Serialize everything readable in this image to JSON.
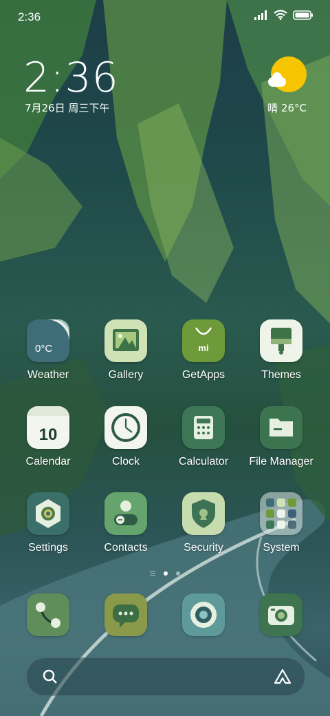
{
  "status_bar": {
    "time": "2:36"
  },
  "clock_widget": {
    "time": "2:36",
    "date": "7月26日 周三下午"
  },
  "weather_widget": {
    "text": "晴 26°C",
    "icon": "sunny-cloud-icon"
  },
  "apps": [
    {
      "label": "Weather",
      "icon_text": "0°C"
    },
    {
      "label": "Gallery"
    },
    {
      "label": "GetApps",
      "icon_text": "mi"
    },
    {
      "label": "Themes"
    },
    {
      "label": "Calendar",
      "icon_text": "10"
    },
    {
      "label": "Clock"
    },
    {
      "label": "Calculator"
    },
    {
      "label": "File Manager"
    },
    {
      "label": "Settings"
    },
    {
      "label": "Contacts"
    },
    {
      "label": "Security"
    },
    {
      "label": "System"
    }
  ],
  "dock": [
    {
      "name": "phone-icon"
    },
    {
      "name": "messages-icon"
    },
    {
      "name": "browser-icon"
    },
    {
      "name": "camera-icon"
    }
  ],
  "page_indicator": {
    "pages": 2,
    "current": 1
  },
  "colors": {
    "weather_bg": "#3e6d78",
    "gallery_bg": "#cfe2b6",
    "getapps_bg": "#6e9a3a",
    "themes_bg": "#eef4ea",
    "calendar_bg": "#f2f6ee",
    "clock_bg": "#f2f6ee",
    "calculator_bg": "#3d7755",
    "filemanager_bg": "#3c7450",
    "settings_bg": "#3b6f6a",
    "contacts_bg": "#66a46e",
    "security_bg": "#c7dcae",
    "sun": "#f6c400"
  }
}
